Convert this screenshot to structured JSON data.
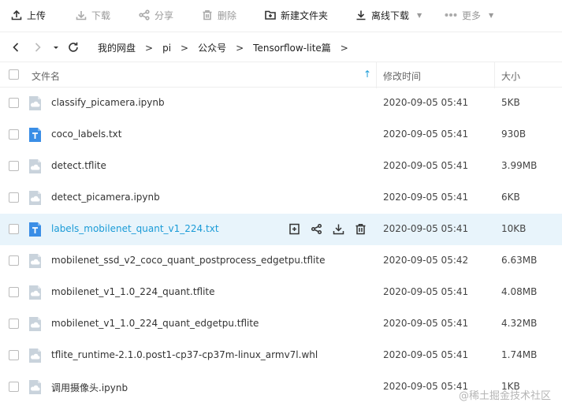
{
  "toolbar": {
    "upload": "上传",
    "download": "下载",
    "share": "分享",
    "delete": "删除",
    "new_folder": "新建文件夹",
    "offline_download": "离线下载",
    "more": "更多"
  },
  "breadcrumb": {
    "items": [
      "我的网盘",
      "pi",
      "公众号",
      "Tensorflow-lite篇"
    ],
    "separator": ">"
  },
  "columns": {
    "name": "文件名",
    "modified": "修改时间",
    "size": "大小"
  },
  "files": [
    {
      "name": "classify_picamera.ipynb",
      "time": "2020-09-05 05:41",
      "size": "5KB",
      "type": "cloud"
    },
    {
      "name": "coco_labels.txt",
      "time": "2020-09-05 05:41",
      "size": "930B",
      "type": "text"
    },
    {
      "name": "detect.tflite",
      "time": "2020-09-05 05:41",
      "size": "3.99MB",
      "type": "cloud"
    },
    {
      "name": "detect_picamera.ipynb",
      "time": "2020-09-05 05:41",
      "size": "6KB",
      "type": "cloud"
    },
    {
      "name": "labels_mobilenet_quant_v1_224.txt",
      "time": "2020-09-05 05:41",
      "size": "10KB",
      "type": "text"
    },
    {
      "name": "mobilenet_ssd_v2_coco_quant_postprocess_edgetpu.tflite",
      "time": "2020-09-05 05:42",
      "size": "6.63MB",
      "type": "cloud"
    },
    {
      "name": "mobilenet_v1_1.0_224_quant.tflite",
      "time": "2020-09-05 05:41",
      "size": "4.08MB",
      "type": "cloud"
    },
    {
      "name": "mobilenet_v1_1.0_224_quant_edgetpu.tflite",
      "time": "2020-09-05 05:41",
      "size": "4.32MB",
      "type": "cloud"
    },
    {
      "name": "tflite_runtime-2.1.0.post1-cp37-cp37m-linux_armv7l.whl",
      "time": "2020-09-05 05:41",
      "size": "1.74MB",
      "type": "cloud"
    },
    {
      "name": "调用摄像头.ipynb",
      "time": "2020-09-05 05:41",
      "size": "1KB",
      "type": "cloud"
    }
  ],
  "hover_row_index": 4,
  "watermark": "@稀土掘金技术社区",
  "colors": {
    "accent": "#1a9bd7",
    "hover_bg": "#e8f4fb",
    "text_icon": "#3a8ee6",
    "cloud_icon": "#c9d3dc"
  }
}
